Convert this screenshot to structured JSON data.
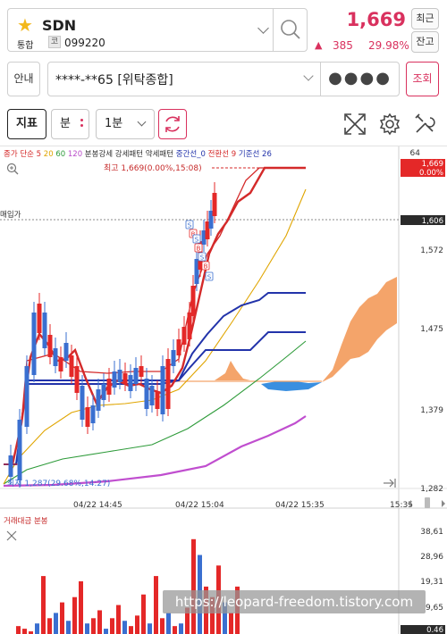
{
  "header": {
    "stock_name": "SDN",
    "market_label": "통합",
    "code_badge": "코",
    "stock_code": "099220",
    "price": "1,669",
    "change_symbol": "▲",
    "change_amount": "385",
    "change_rate": "29.98%",
    "recent_label": "최근",
    "balance_label": "잔고"
  },
  "account": {
    "info_label": "안내",
    "account_text": "****-**65 [위탁종합]",
    "password_mask": "●●●●",
    "query_label": "조회"
  },
  "toolbar": {
    "indicator_label": "지표",
    "unit_label": "분",
    "period_label": "1분"
  },
  "chart": {
    "legend": [
      {
        "text": "종가 단순",
        "color": "#d42a2a"
      },
      {
        "text": "5",
        "color": "#d42a2a"
      },
      {
        "text": "20",
        "color": "#e0a500"
      },
      {
        "text": "60",
        "color": "#2e9b3a"
      },
      {
        "text": "120",
        "color": "#b94bc9"
      },
      {
        "text": "분봉강세 강세패턴 약세패턴",
        "color": "#333333"
      },
      {
        "text": "중간선_0",
        "color": "#2233aa"
      },
      {
        "text": "전환선 9",
        "color": "#d42a2a"
      },
      {
        "text": "기준선 26",
        "color": "#2233aa"
      }
    ],
    "high_annotation": "최고 1,669(0.00%,15:08)",
    "low_annotation": "최저 1,287(29.68%,14:27)",
    "avg_price_label": "매입가",
    "price_axis_ticks": [
      "1,572",
      "1,475",
      "1,379",
      "1,282"
    ],
    "price_axis_top": "64",
    "current_price_tag": "1,669",
    "current_rate_tag": "0.00%",
    "avg_price_tag": "1,606",
    "time_labels": [
      "04/22 14:45",
      "04/22 15:04",
      "04/22 15:35",
      "15:35"
    ],
    "volume_title": "거래대금 분봉",
    "volume_ticks": [
      "38,61",
      "28,96",
      "19,31",
      "9,65",
      "0.46"
    ]
  },
  "chart_data": {
    "type": "candlestick",
    "title": "",
    "ylim": [
      1260,
      1700
    ],
    "high": 1669,
    "low": 1287,
    "current": 1669,
    "avg_price": 1606,
    "volume_series": [
      3,
      2,
      1,
      4,
      22,
      6,
      8,
      12,
      5,
      14,
      20,
      4,
      6,
      9,
      2,
      6,
      11,
      5,
      3,
      7,
      15,
      4,
      22,
      6,
      8,
      3,
      4,
      10,
      36,
      30,
      18,
      14,
      26,
      12,
      8,
      18
    ]
  },
  "watermark": "https://leopard-freedom.tistory.com"
}
